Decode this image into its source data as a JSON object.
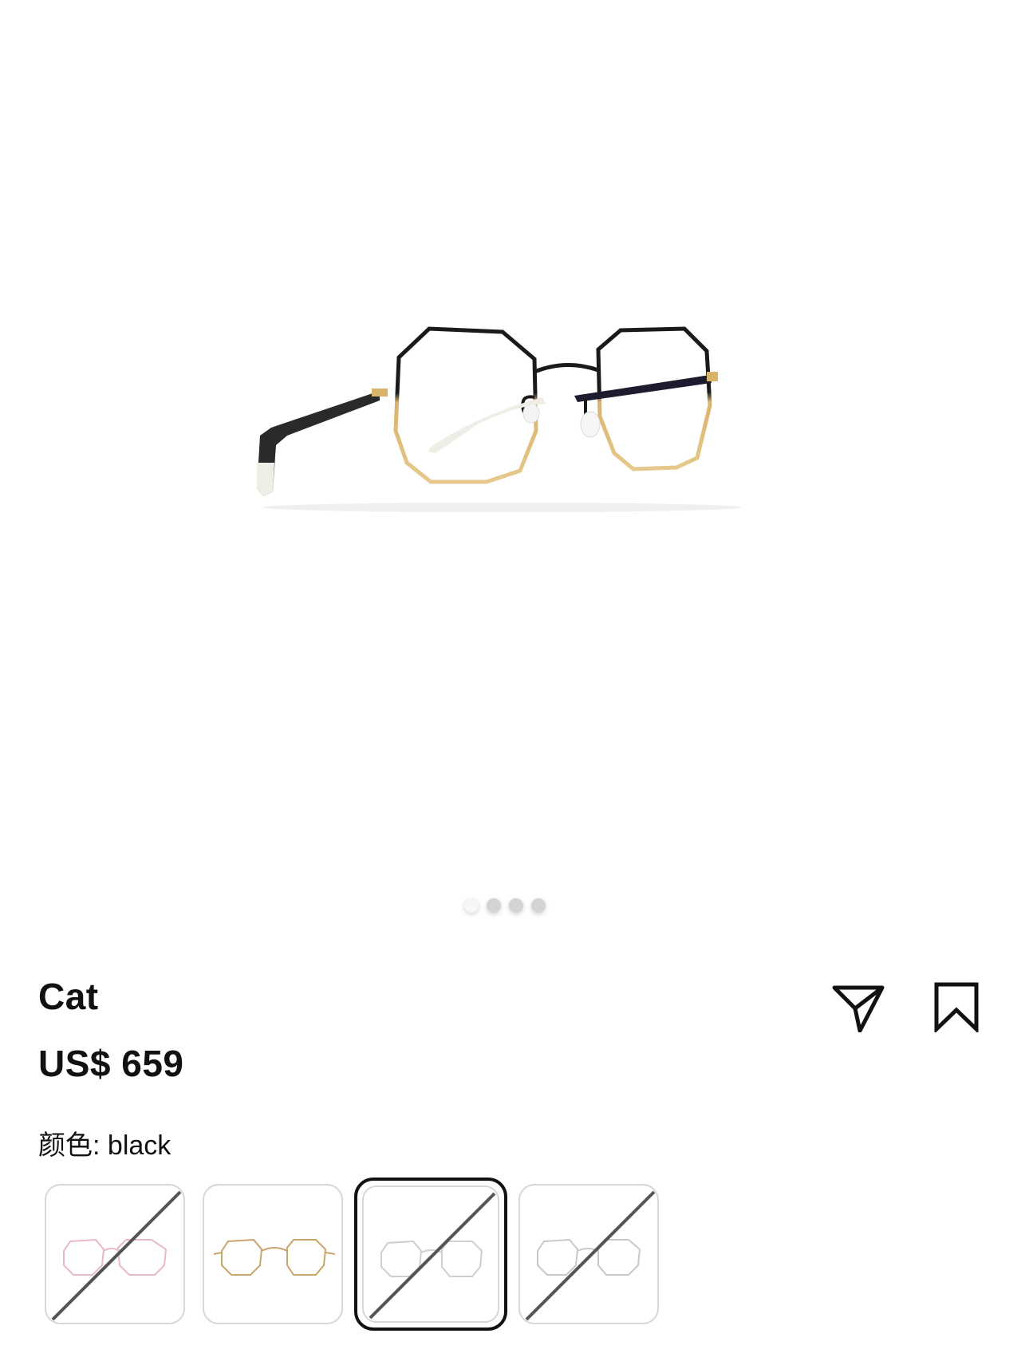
{
  "product": {
    "name": "Cat",
    "price": "US$ 659",
    "color_label": "颜色:",
    "color_value": "black"
  },
  "gallery": {
    "image_count": 4,
    "active_index": 0
  },
  "actions": {
    "share_icon": "send-icon",
    "bookmark_icon": "bookmark-icon"
  },
  "swatches": [
    {
      "frame_color": "#e8b9c8",
      "available": false,
      "selected": false
    },
    {
      "frame_color": "#c9a56b",
      "available": true,
      "selected": false
    },
    {
      "frame_color": "#cfcfcf",
      "available": false,
      "selected": true
    },
    {
      "frame_color": "#c8c8c8",
      "available": false,
      "selected": false
    }
  ],
  "colors": {
    "text": "#111111",
    "frame_black": "#1a1a1a",
    "frame_gold": "#d9b36a",
    "temple_tip": "#efeee6",
    "strike": "#555555"
  }
}
